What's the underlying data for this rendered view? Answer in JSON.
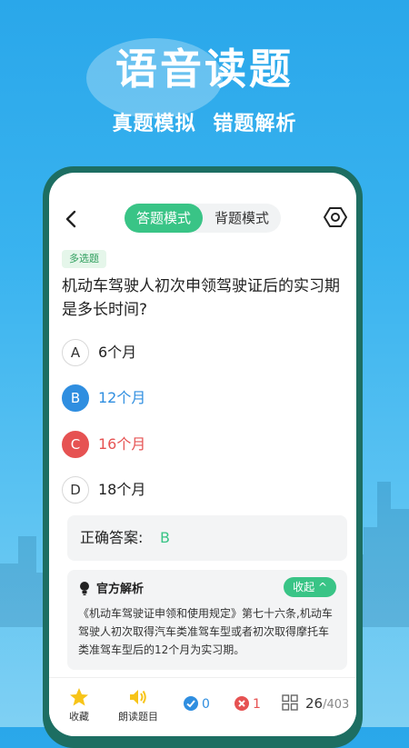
{
  "promo": {
    "title": "语音读题",
    "subtitle": "真题模拟  错题解析"
  },
  "header": {
    "back_icon": "chevron-left-icon",
    "tabs": [
      {
        "label": "答题模式",
        "active": true
      },
      {
        "label": "背题模式",
        "active": false
      }
    ],
    "settings_icon": "hexagon-settings-icon"
  },
  "question": {
    "type": "多选题",
    "text": "机动车驾驶人初次申领驾驶证后的实习期是多长时间?",
    "options": [
      {
        "letter": "A",
        "text": "6个月",
        "state": "normal"
      },
      {
        "letter": "B",
        "text": "12个月",
        "state": "correct"
      },
      {
        "letter": "C",
        "text": "16个月",
        "state": "wrong"
      },
      {
        "letter": "D",
        "text": "18个月",
        "state": "normal"
      }
    ]
  },
  "answer": {
    "label": "正确答案:",
    "value": "B"
  },
  "analysis": {
    "title": "官方解析",
    "collapse_label": "收起 ^",
    "text": "《机动车驾驶证申领和使用规定》第七十六条,机动车驾驶人初次取得汽车类准驾车型或者初次取得摩托车类准驾车型后的12个月为实习期。"
  },
  "bottom_bar": {
    "favorite_label": "收藏",
    "read_label": "朗读题目",
    "correct_count": "0",
    "wrong_count": "1",
    "current": "26",
    "total": "/403"
  },
  "colors": {
    "accent_green": "#39c486",
    "correct_blue": "#2f8ee0",
    "wrong_red": "#e65252",
    "background_blue": "#2aa7ea"
  }
}
